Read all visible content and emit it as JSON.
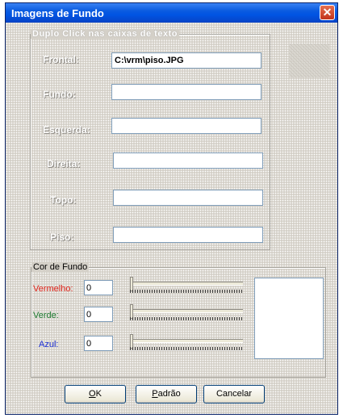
{
  "window": {
    "title": "Imagens de Fundo",
    "close_glyph": "✕"
  },
  "images": {
    "legend": "Duplo Click nas caixas de texto",
    "fields": [
      {
        "label": "Frontal:",
        "value": "C:\\vrm\\piso.JPG"
      },
      {
        "label": "Fundo:",
        "value": ""
      },
      {
        "label": "Esquerda:",
        "value": ""
      },
      {
        "label": "Direita:",
        "value": ""
      },
      {
        "label": "Topo:",
        "value": ""
      },
      {
        "label": "Piso:",
        "value": ""
      }
    ]
  },
  "color": {
    "legend": "Cor de Fundo",
    "red": {
      "label": "Vermelho:",
      "value": "0",
      "color": "#e0241b"
    },
    "green": {
      "label": "Verde:",
      "value": "0",
      "color": "#1d7a30"
    },
    "blue": {
      "label": "Azul:",
      "value": "0",
      "color": "#1c2fd4"
    },
    "preview_color": "#ffffff"
  },
  "buttons": {
    "ok_mnemonic": "O",
    "ok_rest": "K",
    "default_mnemonic": "P",
    "default_rest": "adrão",
    "cancel": "Cancelar"
  }
}
